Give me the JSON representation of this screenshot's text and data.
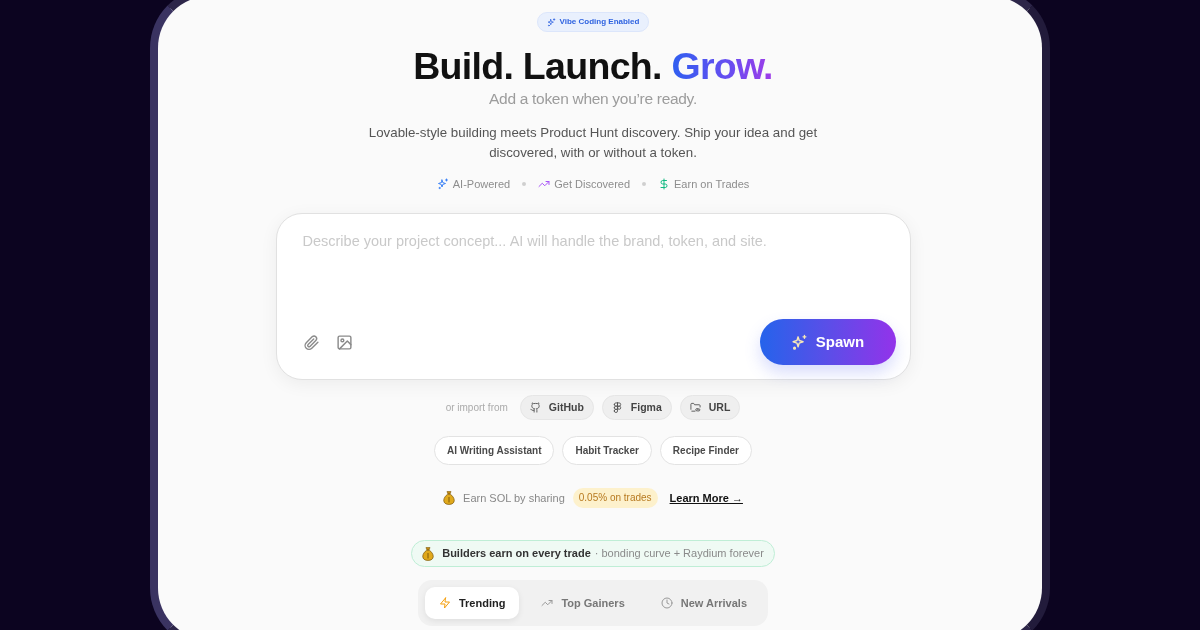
{
  "badge": {
    "label": "Vibe Coding Enabled"
  },
  "hero": {
    "title_lead": "Build. Launch.",
    "title_accent": "Grow.",
    "subtitle": "Add a token when you’re ready.",
    "description": "Lovable-style building meets Product Hunt discovery. Ship your idea and get discovered, with or without a token."
  },
  "features": [
    {
      "label": "AI-Powered"
    },
    {
      "label": "Get Discovered"
    },
    {
      "label": "Earn on Trades"
    }
  ],
  "prompt": {
    "placeholder": "Describe your project concept... AI will handle the brand, token, and site.",
    "submit": "Spawn"
  },
  "import": {
    "label": "or import from",
    "sources": [
      "GitHub",
      "Figma",
      "URL"
    ]
  },
  "suggestions": [
    "AI Writing Assistant",
    "Habit Tracker",
    "Recipe Finder"
  ],
  "referral": {
    "text": "Earn SOL by sharing",
    "rate": "0.05% on trades",
    "link": "Learn More →"
  },
  "builders_banner": {
    "headline": "Builders earn on every trade",
    "detail": "· bonding curve + Raydium forever"
  },
  "tabs": [
    {
      "label": "Trending",
      "selected": true
    },
    {
      "label": "Top Gainers",
      "selected": false
    },
    {
      "label": "New Arrivals",
      "selected": false
    }
  ]
}
